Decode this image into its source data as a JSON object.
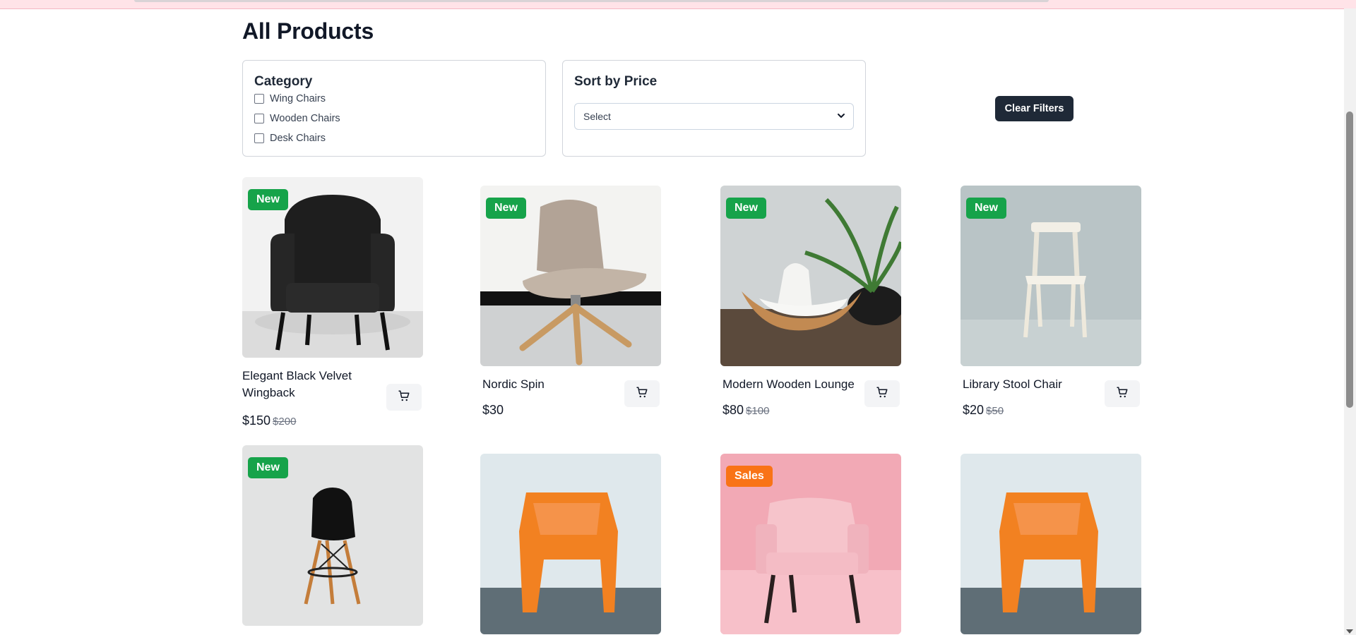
{
  "page": {
    "title": "All Products"
  },
  "filters": {
    "category": {
      "title": "Category",
      "options": [
        "Wing Chairs",
        "Wooden Chairs",
        "Desk Chairs"
      ]
    },
    "sort": {
      "title": "Sort by Price",
      "selected": "Select"
    },
    "clear_label": "Clear Filters"
  },
  "products": [
    {
      "name": "Elegant Black Velvet Wingback",
      "price": "$150",
      "old_price": "$200",
      "badge": "New"
    },
    {
      "name": "Nordic Spin",
      "price": "$30",
      "old_price": "",
      "badge": "New"
    },
    {
      "name": "Modern Wooden Lounge",
      "price": "$80",
      "old_price": "$100",
      "badge": "New"
    },
    {
      "name": "Library Stool Chair",
      "price": "$20",
      "old_price": "$50",
      "badge": "New"
    },
    {
      "badge": "New"
    },
    {
      "badge": ""
    },
    {
      "badge": "Sales"
    },
    {
      "badge": ""
    }
  ],
  "colors": {
    "new_badge": "#16a34a",
    "sales_badge": "#f97316",
    "primary_button": "#1f2937"
  },
  "icons": {
    "cart": "shopping-cart-icon",
    "select": "chevron-down-icon"
  }
}
